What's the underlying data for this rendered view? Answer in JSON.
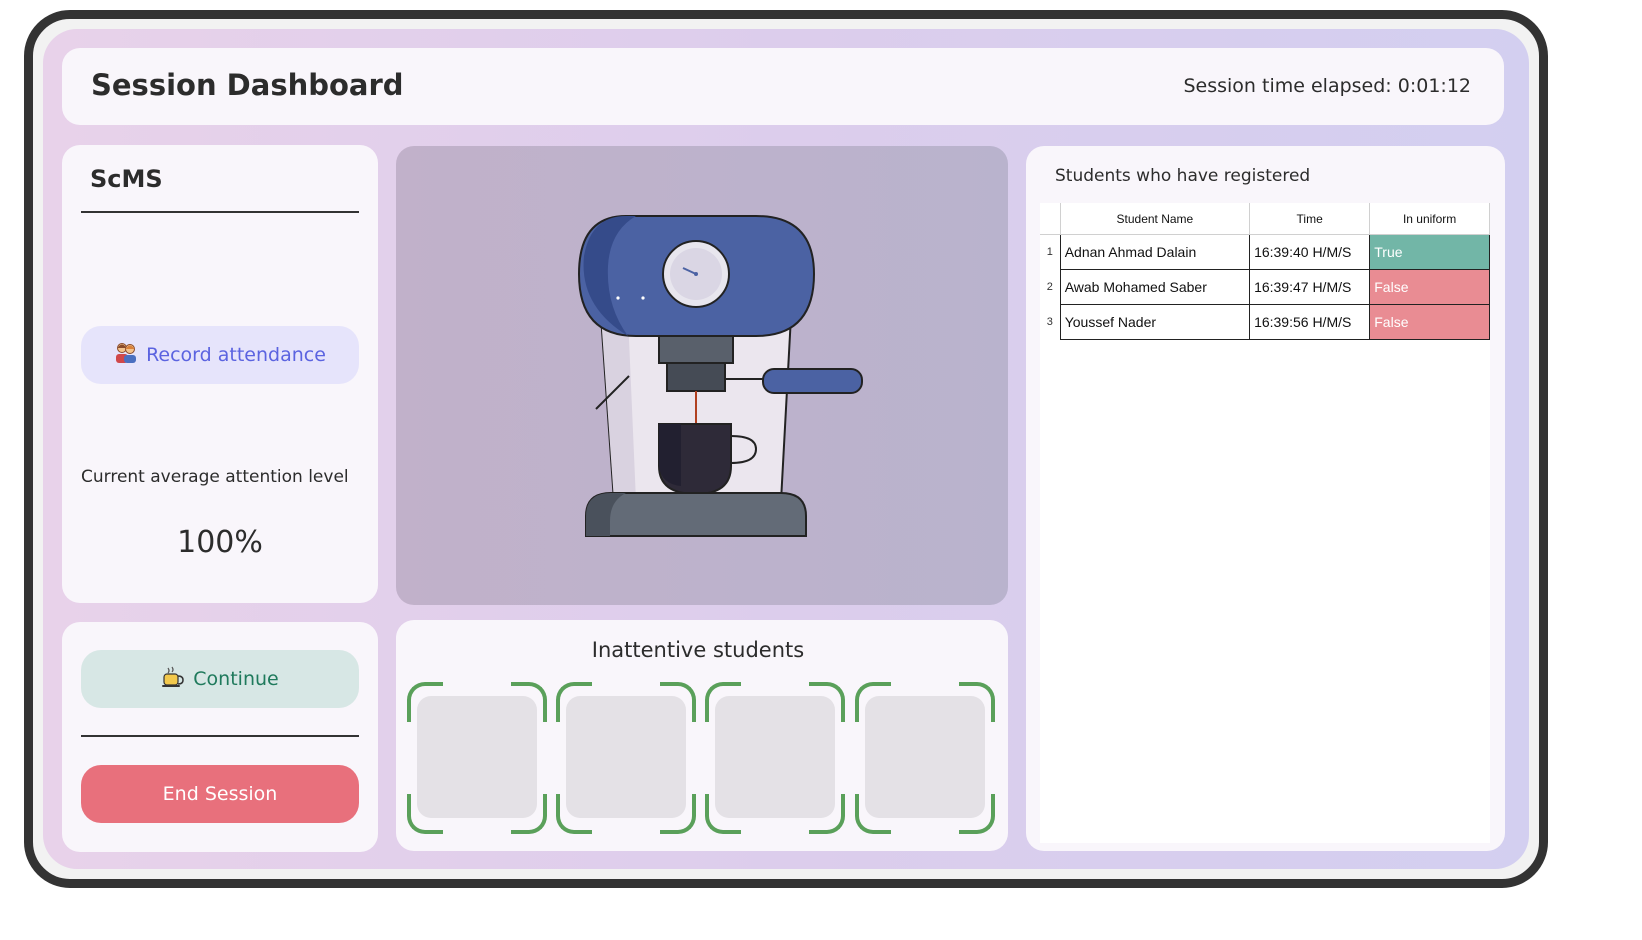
{
  "header": {
    "title": "Session Dashboard",
    "elapsed": "Session time elapsed: 0:01:12"
  },
  "sidebar": {
    "app_name": "ScMS",
    "record_label": "Record attendance",
    "record_icon": "students-icon",
    "attention_label": "Current average attention level",
    "attention_value": "100%"
  },
  "controls": {
    "continue_label": "Continue",
    "continue_icon": "coffee-cup-icon",
    "end_label": "End Session"
  },
  "video": {
    "illustration": "coffee-machine-icon"
  },
  "inattentive": {
    "label": "Inattentive students",
    "slot_count": 4
  },
  "registered": {
    "label": "Students who have registered",
    "columns": [
      "Student Name",
      "Time",
      "In uniform"
    ],
    "rows": [
      {
        "index": "1",
        "name": "Adnan Ahmad Dalain",
        "time": "16:39:40 H/M/S",
        "uniform": "True"
      },
      {
        "index": "2",
        "name": "Awab Mohamed Saber",
        "time": "16:39:47 H/M/S",
        "uniform": "False"
      },
      {
        "index": "3",
        "name": "Youssef Nader",
        "time": "16:39:56 H/M/S",
        "uniform": "False"
      }
    ]
  },
  "colors": {
    "true_cell": "#72b6a7",
    "false_cell": "#e98c93",
    "end_button": "#e8707c",
    "record_text": "#5b63e0",
    "continue_text": "#1f7a5c",
    "frame_corner": "#5aa05a"
  }
}
